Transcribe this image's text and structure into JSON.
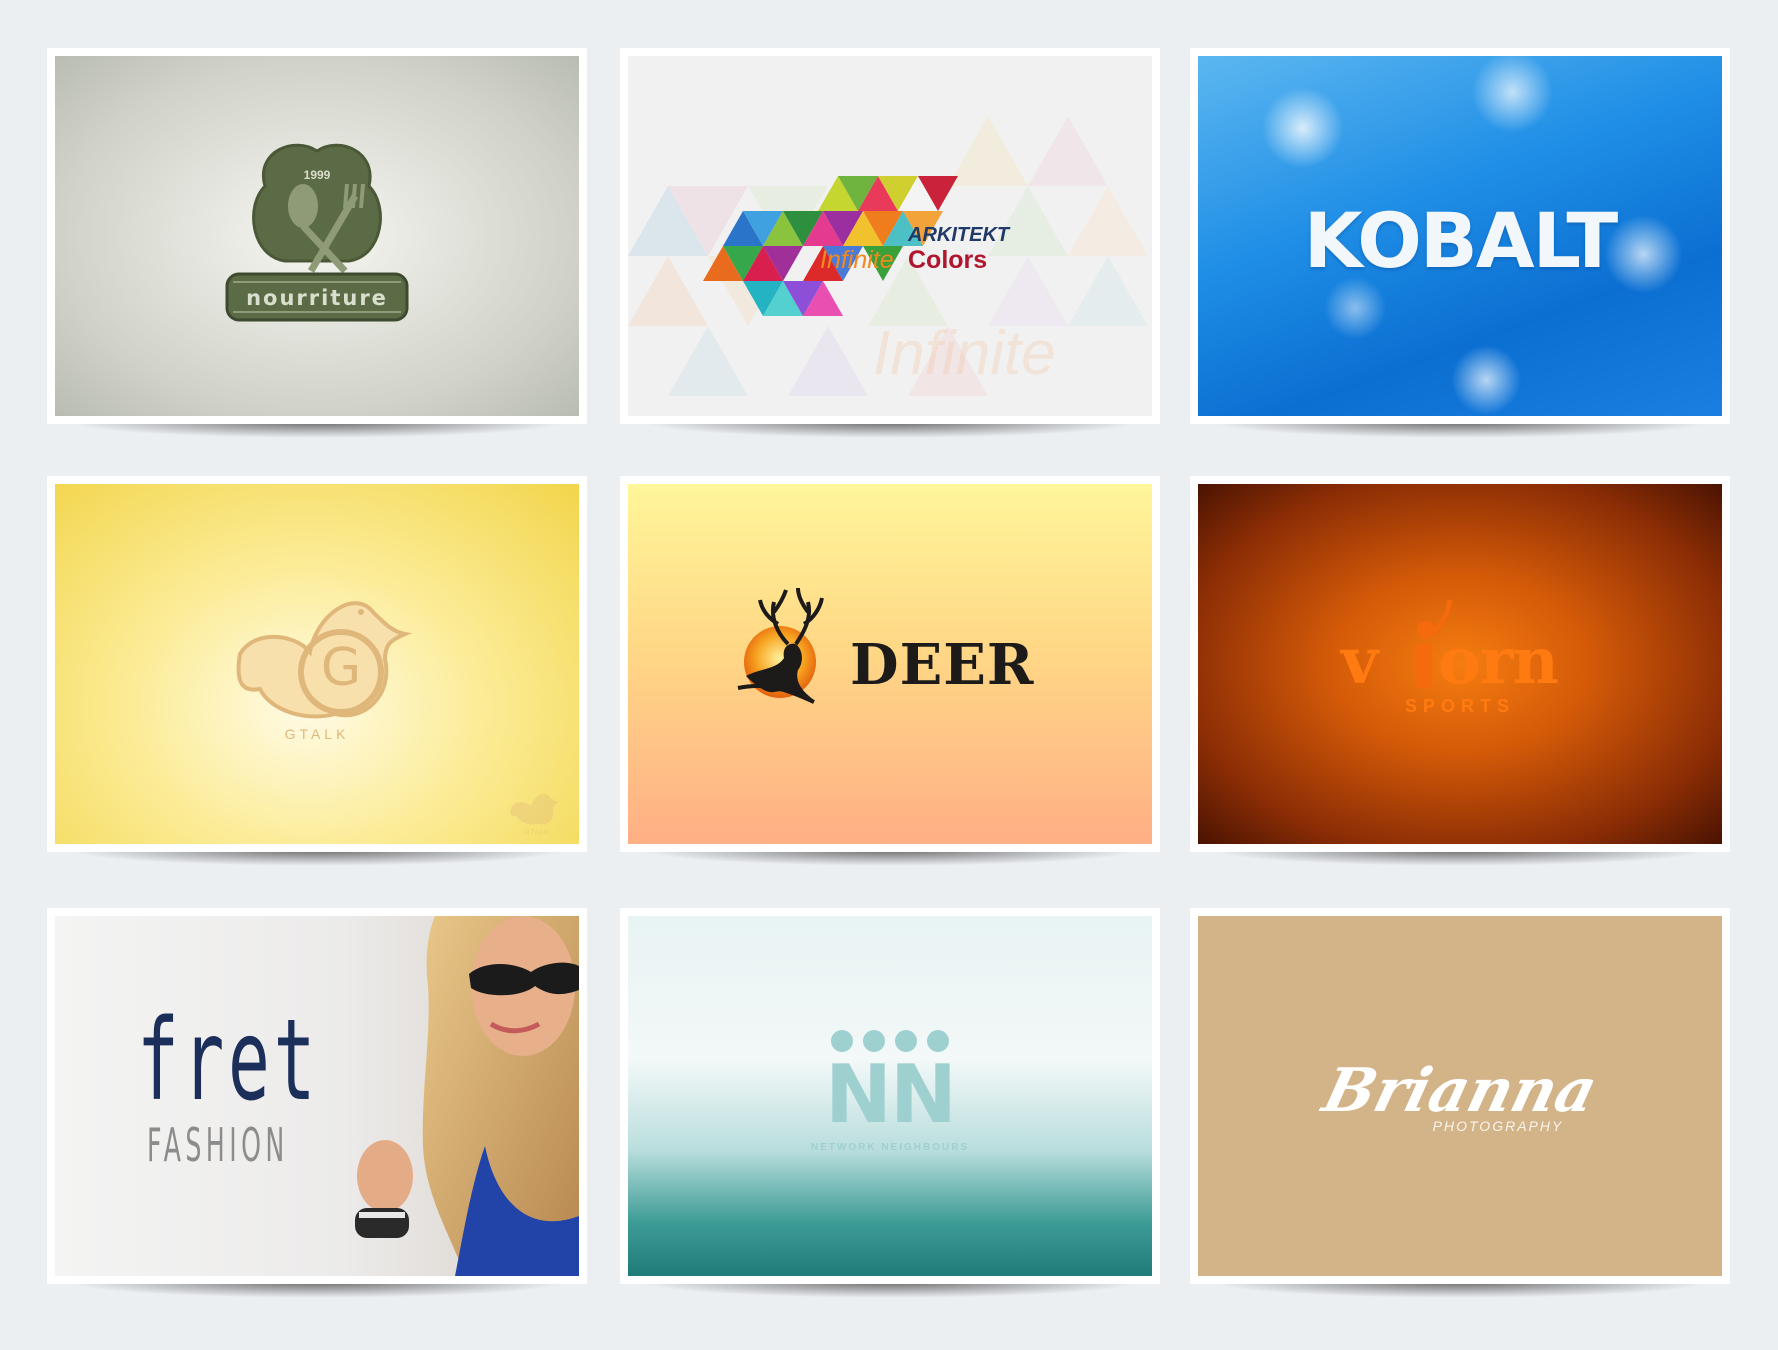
{
  "logos": [
    {
      "name": "nourriture",
      "texts": {
        "year": "1999",
        "word": "nourriture"
      }
    },
    {
      "name": "arkitekt",
      "texts": {
        "brand": "ARKITEKT",
        "tag_a": "Infinite",
        "tag_b": "Colors",
        "watermark": "Infinite"
      }
    },
    {
      "name": "kobalt",
      "texts": {
        "word": "KOBALT"
      }
    },
    {
      "name": "gtalk",
      "texts": {
        "letter": "G",
        "word": "GTALK",
        "small_word": "GTALK"
      }
    },
    {
      "name": "deer",
      "texts": {
        "word": "DEER"
      }
    },
    {
      "name": "viorn",
      "texts": {
        "word_a": "v",
        "word_b": "orn",
        "sub": "SPORTS"
      }
    },
    {
      "name": "fret",
      "texts": {
        "word": "fret",
        "sub": "FASHION"
      }
    },
    {
      "name": "network-neighbours",
      "texts": {
        "word": "NN",
        "sub": "NETWORK NEIGHBOURS"
      }
    },
    {
      "name": "brianna",
      "texts": {
        "word": "Brianna",
        "sub": "PHOTOGRAPHY"
      }
    }
  ],
  "colors": {
    "page_background": "#eceff2",
    "nourriture_green": "#5b6b45",
    "arkitekt_navy": "#1f3a68",
    "arkitekt_orange": "#f08a1d",
    "arkitekt_red": "#b0162e",
    "gtalk_tan": "#e0b77a",
    "deer_dark": "#1c1b19",
    "viorn_orange": "#ff7a10",
    "fret_navy": "#1c2f5a",
    "nn_teal": "#9fd0d0",
    "brianna_white": "#ffffff"
  }
}
